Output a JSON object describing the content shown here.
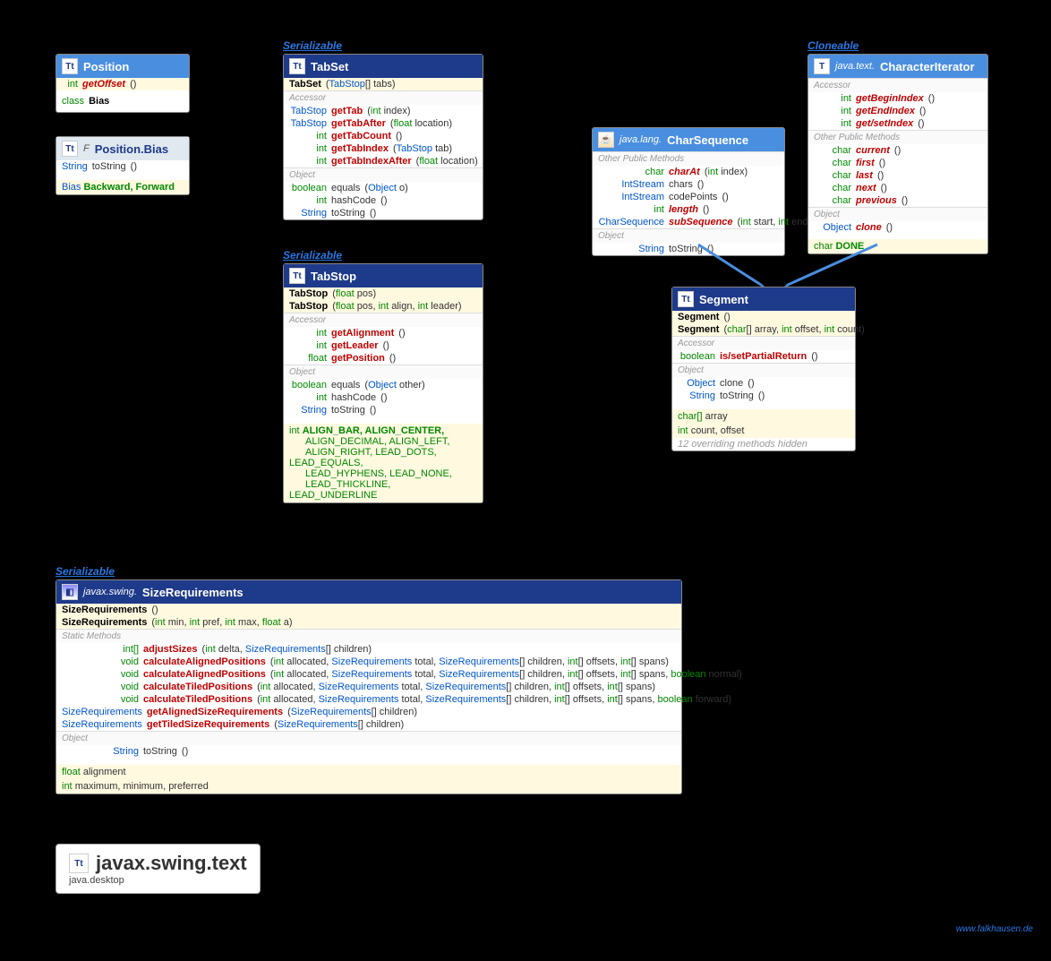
{
  "labels": {
    "serializable": "Serializable",
    "cloneable": "Cloneable"
  },
  "position": {
    "title": "Position",
    "m1": {
      "rt": "int",
      "name": "getOffset",
      "args": "()"
    },
    "inner": {
      "kw": "class",
      "name": "Bias"
    }
  },
  "positionBias": {
    "pkg": "F",
    "title": "Position.Bias",
    "m1": {
      "rt": "String",
      "name": "toString",
      "args": "()"
    },
    "consts": {
      "type": "Bias",
      "vals": "Backward, Forward"
    }
  },
  "tabSet": {
    "title": "TabSet",
    "c1": {
      "name": "TabSet",
      "args": "(TabStop[] tabs)"
    },
    "sec1": "Accessor",
    "m1": {
      "rt": "TabStop",
      "name": "getTab",
      "args": "(int index)"
    },
    "m2": {
      "rt": "TabStop",
      "name": "getTabAfter",
      "args": "(float location)"
    },
    "m3": {
      "rt": "int",
      "name": "getTabCount",
      "args": "()"
    },
    "m4": {
      "rt": "int",
      "name": "getTabIndex",
      "args": "(TabStop tab)"
    },
    "m5": {
      "rt": "int",
      "name": "getTabIndexAfter",
      "args": "(float location)"
    },
    "sec2": "Object",
    "m6": {
      "rt": "boolean",
      "name": "equals",
      "args": "(Object o)"
    },
    "m7": {
      "rt": "int",
      "name": "hashCode",
      "args": "()"
    },
    "m8": {
      "rt": "String",
      "name": "toString",
      "args": "()"
    }
  },
  "tabStop": {
    "title": "TabStop",
    "c1": {
      "name": "TabStop",
      "args": "(float pos)"
    },
    "c2": {
      "name": "TabStop",
      "args": "(float pos, int align, int leader)"
    },
    "sec1": "Accessor",
    "m1": {
      "rt": "int",
      "name": "getAlignment",
      "args": "()"
    },
    "m2": {
      "rt": "int",
      "name": "getLeader",
      "args": "()"
    },
    "m3": {
      "rt": "float",
      "name": "getPosition",
      "args": "()"
    },
    "sec2": "Object",
    "m4": {
      "rt": "boolean",
      "name": "equals",
      "args": "(Object other)"
    },
    "m5": {
      "rt": "int",
      "name": "hashCode",
      "args": "()"
    },
    "m6": {
      "rt": "String",
      "name": "toString",
      "args": "()"
    },
    "consts": {
      "type": "int",
      "l1": "ALIGN_BAR, ALIGN_CENTER,",
      "l2": "ALIGN_DECIMAL, ALIGN_LEFT,",
      "l3": "ALIGN_RIGHT, LEAD_DOTS, LEAD_EQUALS,",
      "l4": "LEAD_HYPHENS, LEAD_NONE,",
      "l5": "LEAD_THICKLINE, LEAD_UNDERLINE"
    }
  },
  "charSeq": {
    "pkg": "java.lang.",
    "title": "CharSequence",
    "sec1": "Other Public Methods",
    "m1": {
      "rt": "char",
      "name": "charAt",
      "args": "(int index)"
    },
    "m2": {
      "rt": "IntStream",
      "name": "chars",
      "args": "()"
    },
    "m3": {
      "rt": "IntStream",
      "name": "codePoints",
      "args": "()"
    },
    "m4": {
      "rt": "int",
      "name": "length",
      "args": "()"
    },
    "m5": {
      "rt": "CharSequence",
      "name": "subSequence",
      "args": "(int start, int end)"
    },
    "sec2": "Object",
    "m6": {
      "rt": "String",
      "name": "toString",
      "args": "()"
    }
  },
  "charIter": {
    "pkg": "java.text.",
    "title": "CharacterIterator",
    "sec1": "Accessor",
    "m1": {
      "rt": "int",
      "name": "getBeginIndex",
      "args": "()"
    },
    "m2": {
      "rt": "int",
      "name": "getEndIndex",
      "args": "()"
    },
    "m3": {
      "rt": "int",
      "name": "get/setIndex",
      "args": "()"
    },
    "sec2": "Other Public Methods",
    "m4": {
      "rt": "char",
      "name": "current",
      "args": "()"
    },
    "m5": {
      "rt": "char",
      "name": "first",
      "args": "()"
    },
    "m6": {
      "rt": "char",
      "name": "last",
      "args": "()"
    },
    "m7": {
      "rt": "char",
      "name": "next",
      "args": "()"
    },
    "m8": {
      "rt": "char",
      "name": "previous",
      "args": "()"
    },
    "sec3": "Object",
    "m9": {
      "rt": "Object",
      "name": "clone",
      "args": "()"
    },
    "consts": {
      "type": "char",
      "name": "DONE"
    }
  },
  "segment": {
    "title": "Segment",
    "c1": {
      "name": "Segment",
      "args": "()"
    },
    "c2": {
      "name": "Segment",
      "args": "(char[] array, int offset, int count)"
    },
    "sec1": "Accessor",
    "m1": {
      "rt": "boolean",
      "name": "is/setPartialReturn",
      "args": "()"
    },
    "sec2": "Object",
    "m2": {
      "rt": "Object",
      "name": "clone",
      "args": "()"
    },
    "m3": {
      "rt": "String",
      "name": "toString",
      "args": "()"
    },
    "f1": {
      "type": "char[]",
      "name": "array"
    },
    "f2": {
      "type": "int",
      "name": "count, offset"
    },
    "note": "12 overriding methods hidden"
  },
  "sizeReq": {
    "pkg": "javax.swing.",
    "title": "SizeRequirements",
    "c1": {
      "name": "SizeRequirements",
      "args": "()"
    },
    "c2": {
      "name": "SizeRequirements",
      "args": "(int min, int pref, int max, float a)"
    },
    "sec1": "Static Methods",
    "m1": {
      "rt": "int[]",
      "name": "adjustSizes",
      "args": "(int delta, SizeRequirements[] children)"
    },
    "m2": {
      "rt": "void",
      "name": "calculateAlignedPositions",
      "args": "(int allocated, SizeRequirements total, SizeRequirements[] children, int[] offsets, int[] spans)"
    },
    "m3": {
      "rt": "void",
      "name": "calculateAlignedPositions",
      "args": "(int allocated, SizeRequirements total, SizeRequirements[] children, int[] offsets, int[] spans, boolean normal)"
    },
    "m4": {
      "rt": "void",
      "name": "calculateTiledPositions",
      "args": "(int allocated, SizeRequirements total, SizeRequirements[] children, int[] offsets, int[] spans)"
    },
    "m5": {
      "rt": "void",
      "name": "calculateTiledPositions",
      "args": "(int allocated, SizeRequirements total, SizeRequirements[] children, int[] offsets, int[] spans, boolean forward)"
    },
    "m6": {
      "rt": "SizeRequirements",
      "name": "getAlignedSizeRequirements",
      "args": "(SizeRequirements[] children)"
    },
    "m7": {
      "rt": "SizeRequirements",
      "name": "getTiledSizeRequirements",
      "args": "(SizeRequirements[] children)"
    },
    "sec2": "Object",
    "m8": {
      "rt": "String",
      "name": "toString",
      "args": "()"
    },
    "f1": {
      "type": "float",
      "name": "alignment"
    },
    "f2": {
      "type": "int",
      "name": "maximum, minimum, preferred"
    }
  },
  "package": {
    "name": "javax.swing.text",
    "module": "java.desktop"
  },
  "footer": "www.falkhausen.de"
}
